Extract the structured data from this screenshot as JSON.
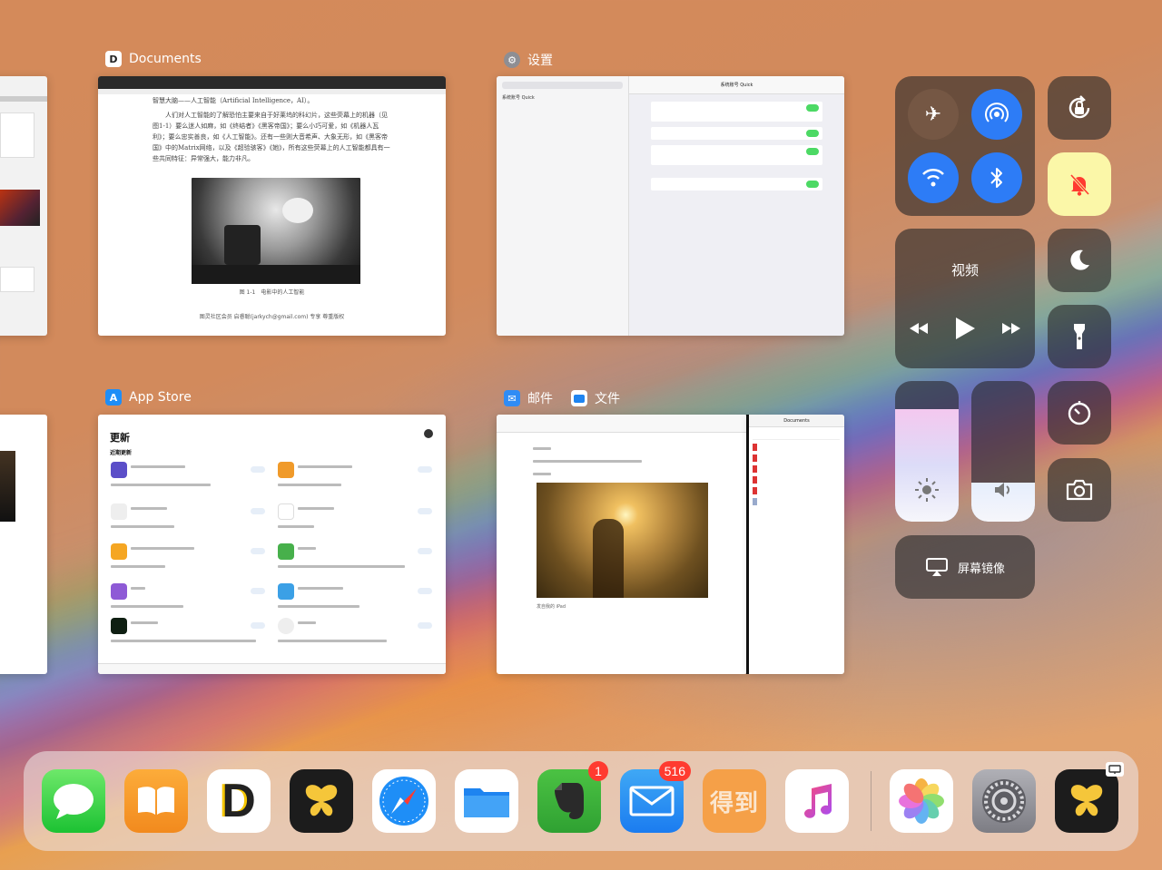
{
  "app_switcher": {
    "documents": {
      "label": "Documents",
      "doc_text_top": "智慧大脑——人工智能（Artificial Intelligence，AI）。",
      "doc_text_body": "人们对人工智能的了解恐怕主要来自于好莱坞的科幻片，这些荧幕上的机器（见图1-1）要么迷人如麻，如《终结者》《黑客帝国》；要么小巧可爱，如《机器人瓦利》；要么忠实善良，如《人工智能》。还有一些则大音希声、大象无形，如《黑客帝国》中的Matrix网络，以及《超验骇客》《她》，所有这些荧幕上的人工智能都具有一些共同特征：异常强大，能力非凡。",
      "figure_caption": "图 1-1　电影中的人工智能",
      "footer": "图灵社区会员 启睿聪(jarkych@gmail.com) 专享 尊重版权"
    },
    "settings": {
      "label": "设置",
      "sidebar_item": "系统账号 Quick",
      "header": "系统账号 Quick"
    },
    "app_store": {
      "label": "App Store",
      "title": "更新",
      "subtitle": "近期更新"
    },
    "mail": {
      "label": "邮件",
      "caption": "发自我的 iPad"
    },
    "files": {
      "label": "文件",
      "title": "Documents"
    }
  },
  "control_center": {
    "media_title": "视频",
    "screen_mirroring": "屏幕镜像",
    "brightness_level": 0.8,
    "volume_level": 0.28
  },
  "dock": {
    "apps": [
      {
        "name": "messages"
      },
      {
        "name": "books"
      },
      {
        "name": "documents",
        "glyph": "D"
      },
      {
        "name": "ulysses"
      },
      {
        "name": "safari"
      },
      {
        "name": "files"
      },
      {
        "name": "evernote",
        "badge": "1"
      },
      {
        "name": "mail",
        "badge": "516"
      },
      {
        "name": "dedao",
        "glyph": "得到"
      },
      {
        "name": "music"
      },
      {
        "name": "photos"
      },
      {
        "name": "settings"
      },
      {
        "name": "ulysses-recent"
      }
    ]
  }
}
